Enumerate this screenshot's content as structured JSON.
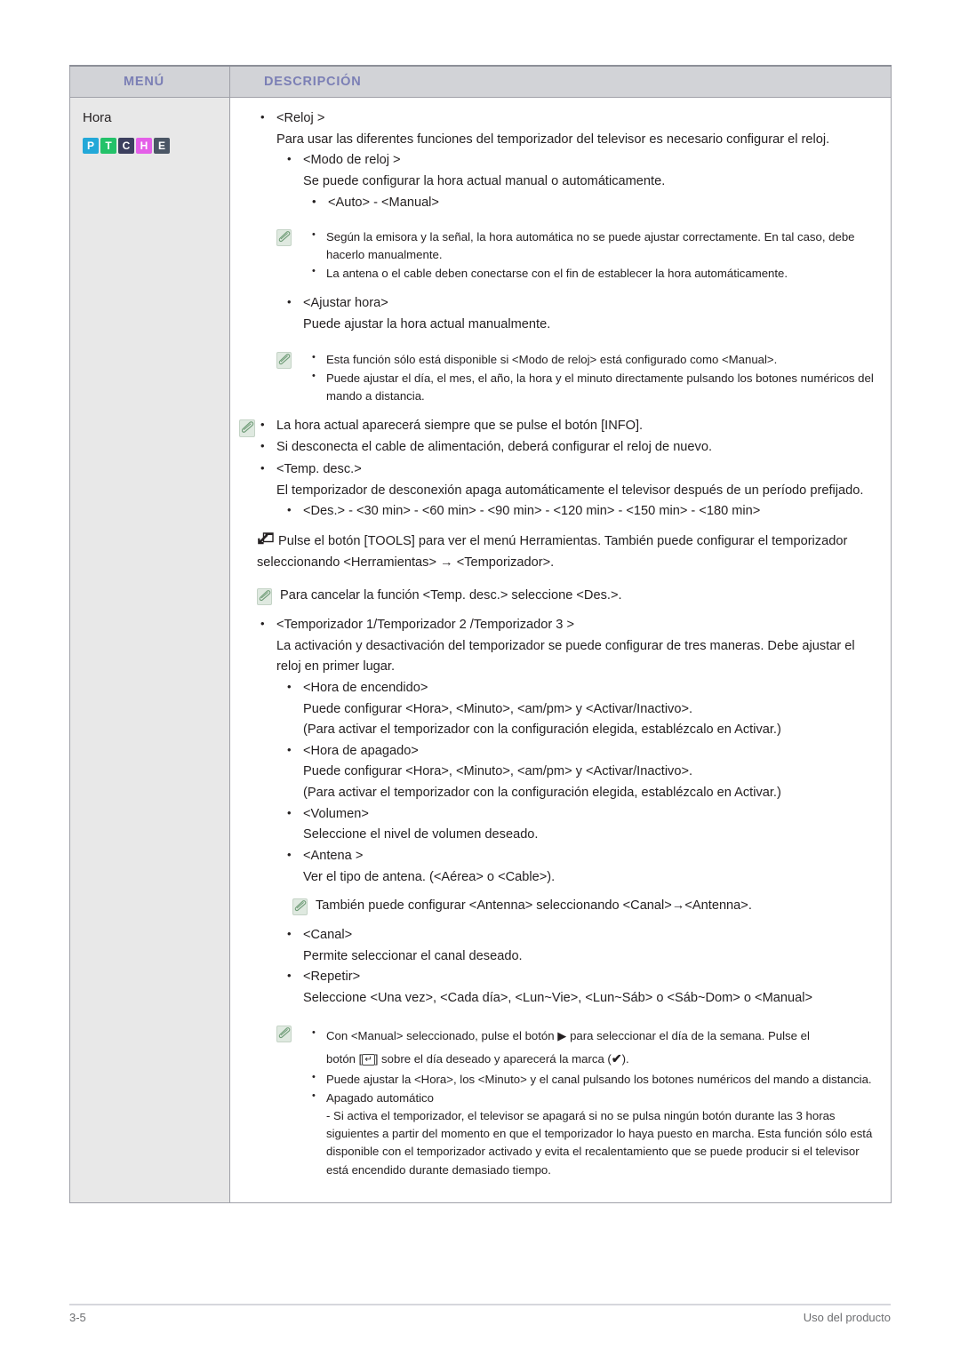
{
  "table": {
    "headers": {
      "menu": "MENÚ",
      "description": "DESCRIPCIÓN"
    },
    "header_text_color": "#7b7fb5",
    "header_bg_color": "#d2d3d7",
    "menu_cell_bg_color": "#e8e8e8"
  },
  "menu": {
    "title": "Hora",
    "badges": [
      {
        "letter": "P",
        "color": "#23a8d8"
      },
      {
        "letter": "T",
        "color": "#23c269"
      },
      {
        "letter": "C",
        "color": "#3c3f5e"
      },
      {
        "letter": "H",
        "color": "#e45fe8"
      },
      {
        "letter": "E",
        "color": "#4b5665"
      }
    ]
  },
  "content": {
    "reloj_heading": "<Reloj >",
    "reloj_desc": "Para usar las diferentes funciones del temporizador del televisor es necesario configurar el reloj.",
    "modo_reloj_heading": "<Modo de reloj >",
    "modo_reloj_desc": "Se puede configurar la hora actual manual o automáticamente.",
    "auto_manual": "<Auto> - <Manual>",
    "note1_item1": "Según la emisora y la señal, la hora automática no se puede ajustar correctamente. En tal caso, debe hacerlo manualmente.",
    "note1_item2": "La antena o el cable deben conectarse con el fin de establecer la hora automáticamente.",
    "ajustar_hora_heading": "<Ajustar hora>",
    "ajustar_hora_desc": "Puede ajustar la hora actual manualmente.",
    "note2_item1": "Esta función sólo está disponible si <Modo de reloj> está configurado como <Manual>.",
    "note2_item2": "Puede ajustar el día, el mes, el año, la hora y el minuto directamente pulsando los botones numéricos del mando a distancia.",
    "note3_item1": "La hora actual aparecerá siempre que se pulse el botón [INFO].",
    "note3_item2": "Si desconecta el cable de alimentación, deberá configurar el reloj de nuevo.",
    "temp_desc_heading": "<Temp. desc.>",
    "temp_desc_body": "El temporizador de desconexión apaga automáticamente el televisor después de un período prefijado.",
    "temp_desc_options": "<Des.> - <30 min> - <60 min> - <90 min> - <120 min> - <150 min> - <180 min>",
    "tools_text": "Pulse el botón [TOOLS] para ver el menú Herramientas. También puede configurar el temporizador seleccionando <Herramientas> → <Temporizador>.",
    "cancel_note": "Para cancelar la función <Temp. desc.> seleccione <Des.>.",
    "temporizador_heading": "<Temporizador 1/Temporizador 2 /Temporizador 3 >",
    "temporizador_body": "La activación y desactivación del temporizador se puede configurar de tres maneras. Debe ajustar el reloj en primer lugar.",
    "hora_encendido_heading": "<Hora de encendido>",
    "hora_encendido_line1": "Puede configurar <Hora>, <Minuto>, <am/pm> y <Activar/Inactivo>.",
    "hora_encendido_line2": "(Para activar el temporizador con la configuración elegida, establézcalo en Activar.)",
    "hora_apagado_heading": "<Hora de apagado>",
    "hora_apagado_line1": "Puede configurar <Hora>, <Minuto>, <am/pm> y <Activar/Inactivo>.",
    "hora_apagado_line2": "(Para activar el temporizador con la configuración elegida, establézcalo en Activar.)",
    "volumen_heading": "<Volumen>",
    "volumen_desc": "Seleccione el nivel de volumen deseado.",
    "antena_heading": "<Antena >",
    "antena_desc": "Ver el tipo de antena. (<Aérea> o <Cable>).",
    "antena_note": "También puede configurar <Antenna> seleccionando <Canal>→<Antenna>.",
    "canal_heading": "<Canal>",
    "canal_desc": "Permite seleccionar el canal deseado.",
    "repetir_heading": "<Repetir>",
    "repetir_desc": "Seleccione <Una vez>, <Cada día>, <Lun~Vie>, <Lun~Sáb> o <Sáb~Dom> o <Manual>",
    "note4_item1_a": "Con <Manual> seleccionado, pulse el botón ",
    "note4_item1_b": " para seleccionar el día de la semana. Pulse el",
    "note4_item1_c": "botón [",
    "note4_item1_d": "] sobre el día deseado y aparecerá la marca (",
    "note4_item1_e": ").",
    "note4_item2": "Puede ajustar la <Hora>, los <Minuto> y el canal pulsando los botones numéricos del mando a distancia.",
    "note4_item3_title": "Apagado automático",
    "note4_item3_body": "- Si activa el temporizador, el televisor se apagará si no se pulsa ningún botón durante las 3 horas siguientes a partir del momento en que el temporizador lo haya puesto en marcha. Esta función sólo está disponible con el temporizador activado y evita el recalentamiento que se puede producir si el televisor está encendido durante demasiado tiempo.",
    "play_glyph": "▶",
    "check_glyph": "✔",
    "enter_glyph": "↵"
  },
  "footer": {
    "page_number": "3-5",
    "section": "Uso del producto"
  }
}
